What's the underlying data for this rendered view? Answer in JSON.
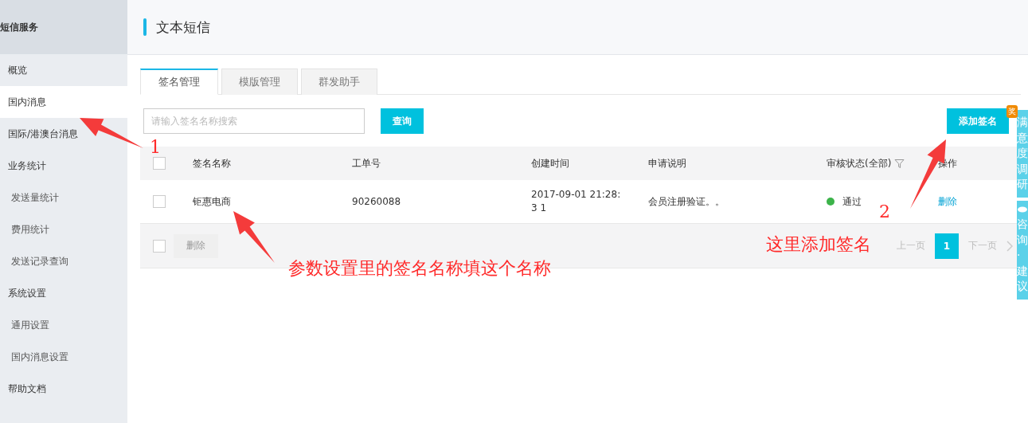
{
  "sidebar": {
    "title": "短信服务",
    "items": [
      {
        "label": "概览",
        "kind": "group",
        "selected": false
      },
      {
        "label": "国内消息",
        "kind": "group",
        "selected": true
      },
      {
        "label": "国际/港澳台消息",
        "kind": "group",
        "selected": false
      },
      {
        "label": "业务统计",
        "kind": "group",
        "selected": false
      },
      {
        "label": "发送量统计",
        "kind": "sub",
        "selected": false
      },
      {
        "label": "费用统计",
        "kind": "sub",
        "selected": false
      },
      {
        "label": "发送记录查询",
        "kind": "sub",
        "selected": false
      },
      {
        "label": "系统设置",
        "kind": "group",
        "selected": false
      },
      {
        "label": "通用设置",
        "kind": "sub",
        "selected": false
      },
      {
        "label": "国内消息设置",
        "kind": "sub",
        "selected": false
      },
      {
        "label": "帮助文档",
        "kind": "group",
        "selected": false
      }
    ]
  },
  "header": {
    "title": "文本短信"
  },
  "tabs": [
    {
      "label": "签名管理",
      "selected": true
    },
    {
      "label": "模版管理",
      "selected": false
    },
    {
      "label": "群发助手",
      "selected": false
    }
  ],
  "search": {
    "placeholder": "请输入签名名称搜索",
    "button": "查询"
  },
  "add_button": "添加签名",
  "table": {
    "header_checked": false,
    "columns": [
      "签名名称",
      "工单号",
      "创建时间",
      "申请说明",
      "审核状态(全部)",
      "操作"
    ],
    "rows": [
      {
        "checked": false,
        "name": "钜惠电商",
        "order": "90260088",
        "created": "2017-09-01 21:28:3 1",
        "note": "会员注册验证。。",
        "status": "通过",
        "color": "#3cb34a",
        "action": "删除"
      }
    ],
    "footer": {
      "checked": false,
      "delete": "删除",
      "prev": "上一页",
      "page": "1",
      "next": "下一页"
    }
  },
  "side_tabs": [
    {
      "label": "满意度调研",
      "badge": "奖"
    },
    {
      "label": "咨询·建议"
    }
  ],
  "annotations": [
    {
      "text": "1"
    },
    {
      "text": "2"
    },
    {
      "text": "参数设置里的签名名称填这个名称"
    },
    {
      "text": "这里添加签名"
    }
  ]
}
